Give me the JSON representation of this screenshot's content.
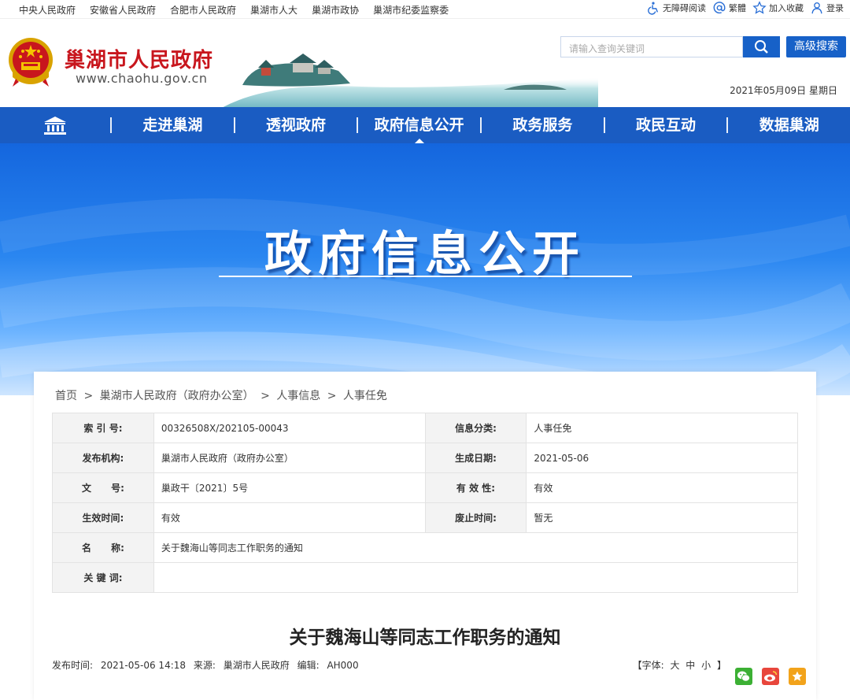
{
  "topbar": {
    "links": [
      "中央人民政府",
      "安徽省人民政府",
      "合肥市人民政府",
      "巢湖市人大",
      "巢湖市政协",
      "巢湖市纪委监察委"
    ],
    "accessible": "无障碍阅读",
    "traditional": "繁體",
    "favorite": "加入收藏",
    "login": "登录"
  },
  "header": {
    "site_name": "巢湖市人民政府",
    "site_url": "www.chaohu.gov.cn",
    "search_placeholder": "请输入查询关键词",
    "advanced_search": "高级搜索",
    "date": "2021年05月09日 星期日"
  },
  "nav": {
    "items": [
      "走进巢湖",
      "透视政府",
      "政府信息公开",
      "政务服务",
      "政民互动",
      "数据巢湖"
    ],
    "active_index": 2
  },
  "banner": {
    "title": "政府信息公开"
  },
  "breadcrumb": [
    "首页",
    ">",
    "巢湖市人民政府（政府办公室）",
    ">",
    "人事信息",
    ">",
    "人事任免"
  ],
  "meta": {
    "index_no_label": "索 引 号:",
    "index_no": "00326508X/202105-00043",
    "category_label": "信息分类:",
    "category": "人事任免",
    "publisher_label": "发布机构:",
    "publisher": "巢湖市人民政府（政府办公室）",
    "created_label": "生成日期:",
    "created": "2021-05-06",
    "doc_no_label": "文      号:",
    "doc_no": "巢政干〔2021〕5号",
    "validity_label": "有 效 性:",
    "validity": "有效",
    "effective_label": "生效时间:",
    "effective": "有效",
    "abolish_label": "废止时间:",
    "abolish": "暂无",
    "name_label": "名      称:",
    "name": "关于魏海山等同志工作职务的通知",
    "keywords_label": "关 键 词:",
    "keywords": ""
  },
  "article": {
    "title": "关于魏海山等同志工作职务的通知",
    "publish_time_label": "发布时间:",
    "publish_time": "2021-05-06 14:18",
    "source_label": "来源:",
    "source": "巢湖市人民政府",
    "editor_label": "编辑:",
    "editor": "AH000",
    "font_label_open": "【字体:",
    "font_large": "大",
    "font_medium": "中",
    "font_small": "小",
    "font_label_close": "】"
  },
  "colors": {
    "brand_blue": "#1a5cc2",
    "title_red": "#c8161d"
  }
}
